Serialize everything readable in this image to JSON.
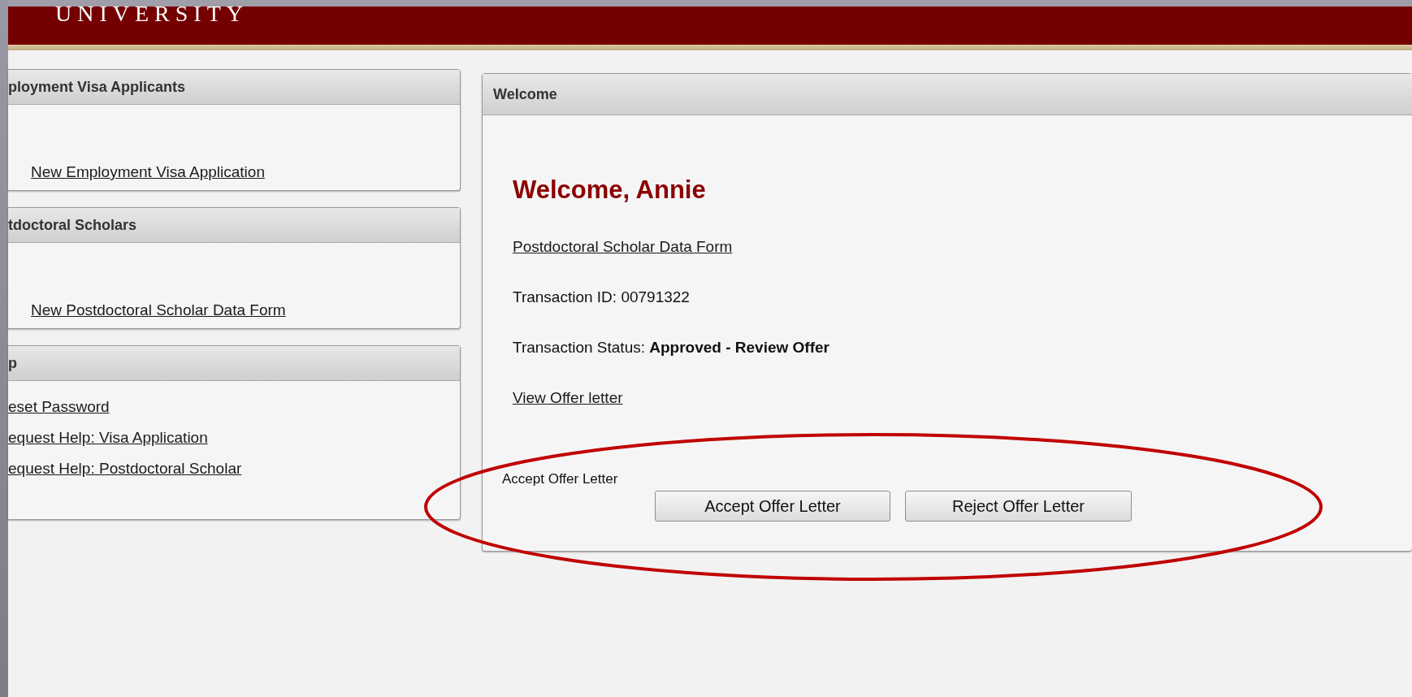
{
  "header": {
    "title": "UNIVERSITY"
  },
  "sidebar": {
    "panels": [
      {
        "title": "ployment Visa Applicants",
        "kind": "form",
        "links": [
          "New Employment Visa Application"
        ]
      },
      {
        "title": "tdoctoral Scholars",
        "kind": "form",
        "links": [
          "New Postdoctoral Scholar Data Form"
        ]
      },
      {
        "title": "p",
        "kind": "help",
        "links": [
          "eset Password",
          "equest Help: Visa Application",
          "equest Help: Postdoctoral Scholar"
        ]
      }
    ]
  },
  "main": {
    "panel_title": "Welcome",
    "greeting": "Welcome, Annie",
    "form_link": "Postdoctoral Scholar Data Form",
    "transaction_id": "Transaction ID: 00791322",
    "transaction_status": "Transaction Status: **Approved - Review Offer**",
    "offer_link": "View Offer letter",
    "accept_label": "Accept Offer Letter",
    "buttons": [
      "Accept Offer Letter",
      "Reject Offer Letter"
    ]
  }
}
